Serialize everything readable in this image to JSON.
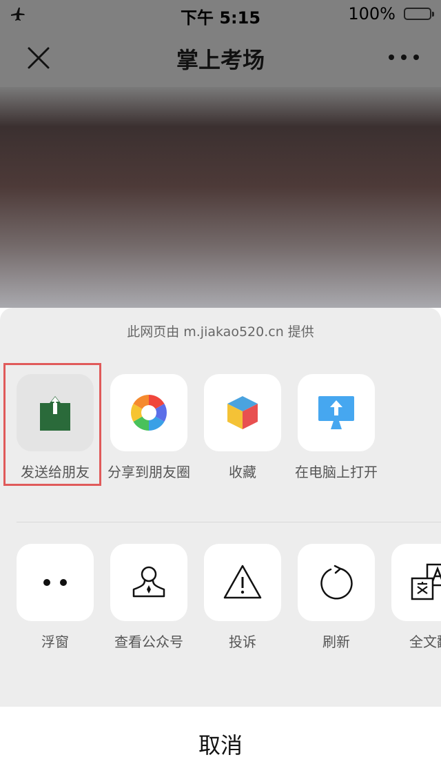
{
  "status_bar": {
    "time": "下午 5:15",
    "battery_percent": "100%",
    "battery_level": 1.0,
    "airplane_icon": "airplane-icon"
  },
  "navbar": {
    "title": "掌上考场",
    "close_icon": "close-icon",
    "more_icon": "more-icon"
  },
  "sheet": {
    "provider_text": "此网页由 m.jiakao520.cn 提供",
    "row1": [
      {
        "label": "发送给朋友",
        "icon": "share-to-friend-icon",
        "selected": true
      },
      {
        "label": "分享到朋友圈",
        "icon": "moments-icon"
      },
      {
        "label": "收藏",
        "icon": "favorite-cube-icon"
      },
      {
        "label": "在电脑上打开",
        "icon": "open-on-computer-icon"
      }
    ],
    "row2": [
      {
        "label": "浮窗",
        "icon": "float-window-icon"
      },
      {
        "label": "查看公众号",
        "icon": "official-account-icon"
      },
      {
        "label": "投诉",
        "icon": "report-warning-icon"
      },
      {
        "label": "刷新",
        "icon": "refresh-icon"
      },
      {
        "label": "全文翻",
        "icon": "translate-icon"
      }
    ],
    "cancel_label": "取消"
  },
  "colors": {
    "overlay_gray": "#808080",
    "sheet_bg": "#ededed",
    "highlight_red": "#e05a5a",
    "share_green": "#2a6a3a",
    "computer_blue": "#46a7f0",
    "battery_yellow": "#f5c400"
  }
}
